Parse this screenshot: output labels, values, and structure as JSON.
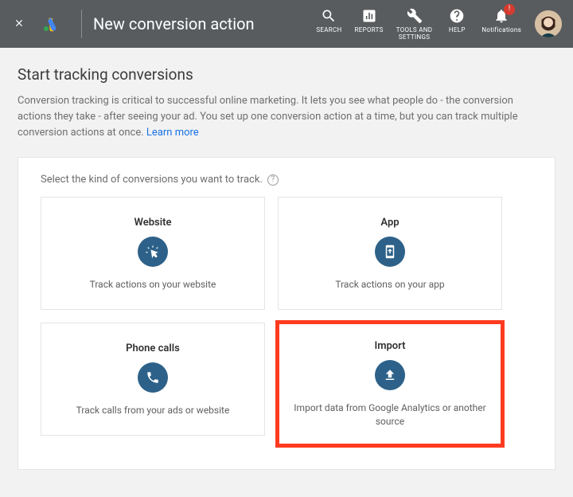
{
  "header": {
    "title": "New conversion action",
    "nav": {
      "search": "SEARCH",
      "reports": "REPORTS",
      "tools": "TOOLS AND\nSETTINGS",
      "help": "HELP",
      "notifications": "Notifications",
      "badge": "!"
    }
  },
  "main": {
    "heading": "Start tracking conversions",
    "intro_text": "Conversion tracking is critical to successful online marketing. It lets you see what people do - the conversion actions they take - after seeing your ad. You set up one conversion action at a time, but you can track multiple conversion actions at once.  ",
    "learn_more": "Learn more",
    "panel_instruction": "Select the kind of conversions you want to track.",
    "help_glyph": "?",
    "cards": {
      "website": {
        "title": "Website",
        "desc": "Track actions on your website"
      },
      "app": {
        "title": "App",
        "desc": "Track actions on your app"
      },
      "phone": {
        "title": "Phone calls",
        "desc": "Track calls from your ads or website"
      },
      "import": {
        "title": "Import",
        "desc": "Import data from Google Analytics or another source"
      }
    }
  }
}
